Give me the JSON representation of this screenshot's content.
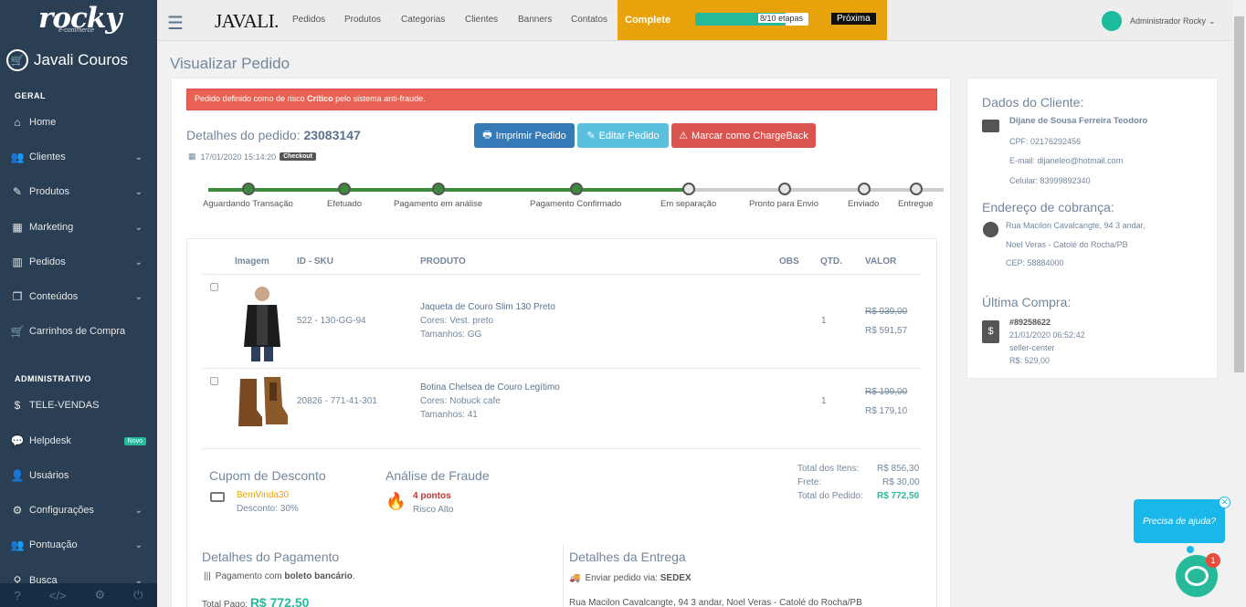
{
  "sidebar": {
    "logo": "rocky",
    "logo_sub": "e-commerce",
    "store": "Javali Couros",
    "sec_geral": "GERAL",
    "sec_admin": "ADMINISTRATIVO",
    "items": [
      {
        "label": "Home",
        "icon": "home-icon"
      },
      {
        "label": "Clientes",
        "icon": "users-icon"
      },
      {
        "label": "Produtos",
        "icon": "edit-icon"
      },
      {
        "label": "Marketing",
        "icon": "grid-icon"
      },
      {
        "label": "Pedidos",
        "icon": "chart-icon"
      },
      {
        "label": "Conteúdos",
        "icon": "copy-icon"
      },
      {
        "label": "Carrinhos de Compra",
        "icon": "cart-icon"
      },
      {
        "label": "TELE-VENDAS",
        "icon": "dollar-icon"
      },
      {
        "label": "Helpdesk",
        "icon": "chat-icon",
        "badge": "Novo"
      },
      {
        "label": "Usuários",
        "icon": "user-icon"
      },
      {
        "label": "Configurações",
        "icon": "gear-icon"
      },
      {
        "label": "Pontuação",
        "icon": "users-icon"
      },
      {
        "label": "Busca",
        "icon": "search-icon"
      }
    ]
  },
  "topbar": {
    "brand": "JAVALI.",
    "nav": [
      "Pedidos",
      "Produtos",
      "Categorias",
      "Clientes",
      "Banners",
      "Contatos"
    ],
    "complete_label": "Complete",
    "progress_text": "8/10 etapas",
    "progress_fraction": 0.8,
    "next_label": "Próxima",
    "admin": "Administrador Rocky"
  },
  "page_title": "Visualizar Pedido",
  "order": {
    "alert_pre": "Pedido definido como de risco ",
    "alert_bold": "Crítico",
    "alert_post": " pelo sistema anti-fraude.",
    "details_label": "Detalhes do pedido: ",
    "number": "23083147",
    "date": "17/01/2020 15:14:20",
    "origin": "Checkout",
    "buttons": {
      "print": "Imprimir Pedido",
      "edit": "Editar Pedido",
      "chargeback": "Marcar como ChargeBack"
    },
    "steps": [
      "Aguardando Transação",
      "Efetuado",
      "Pagamento em análise",
      "Pagamento Confirmado",
      "Em separação",
      "Pronto para Envio",
      "Enviado",
      "Entregue"
    ],
    "steps_done": 4,
    "table_headers": [
      "Imagem",
      "ID - SKU",
      "PRODUTO",
      "OBS",
      "QTD.",
      "VALOR"
    ],
    "items": [
      {
        "sku": "522 - 130-GG-94",
        "name": "Jaqueta de Couro Slim 130 Preto",
        "attr1": "Cores: Vest. preto",
        "attr2": "Tamanhos: GG",
        "qty": "1",
        "old_price": "R$ 939,00",
        "price": "R$ 591,57"
      },
      {
        "sku": "20826 - 771-41-301",
        "name": "Botina Chelsea de Couro Legítimo",
        "attr1": "Cores: Nobuck cafe",
        "attr2": "Tamanhos: 41",
        "qty": "1",
        "old_price": "R$ 199,00",
        "price": "R$ 179,10"
      }
    ],
    "coupon": {
      "title": "Cupom de Desconto",
      "code": "BemVinda30",
      "discount": "Desconto: 30%"
    },
    "fraud": {
      "title": "Análise de Fraude",
      "points": "4 pontos",
      "risk": "Risco Alto"
    },
    "totals": {
      "items_label": "Total dos Itens:",
      "items": "R$ 856,30",
      "freight_label": "Frete:",
      "freight": "R$ 30,00",
      "order_label": "Total do Pedido:",
      "order": "R$ 772,50"
    },
    "payment": {
      "title": "Detalhes do Pagamento",
      "method_pre": "Pagamento com ",
      "method": "boleto bancário",
      "paid_label": "Total Pago: ",
      "paid": "R$ 772,50"
    },
    "delivery": {
      "title": "Detalhes da Entrega",
      "via_label": "Enviar pedido via: ",
      "via": "SEDEX",
      "address": "Rua Macilon Cavalcangte, 94 3 andar, Noel Veras - Catolé do Rocha/PB"
    }
  },
  "customer": {
    "title": "Dados do Cliente:",
    "name": "Dijane de Sousa Ferreira Teodoro",
    "cpf": "CPF: 02176292456",
    "email": "E-mail: dijaneleo@hotmail.com",
    "phone": "Celular: 83999892340",
    "billing_title": "Endereço de cobrança:",
    "addr1": "Rua Macilon Cavalcangte, 94 3 andar,",
    "addr2": "Noel Veras - Catolé do Rocha/PB",
    "cep": "CEP: 58884000",
    "last_title": "Última Compra:",
    "last_id": "#89258622",
    "last_date": "21/01/2020 06:52:42",
    "last_channel": "seller-center",
    "last_value": "R$: 529,00"
  },
  "chat": {
    "text": "Precisa de ajuda?",
    "count": "1"
  }
}
